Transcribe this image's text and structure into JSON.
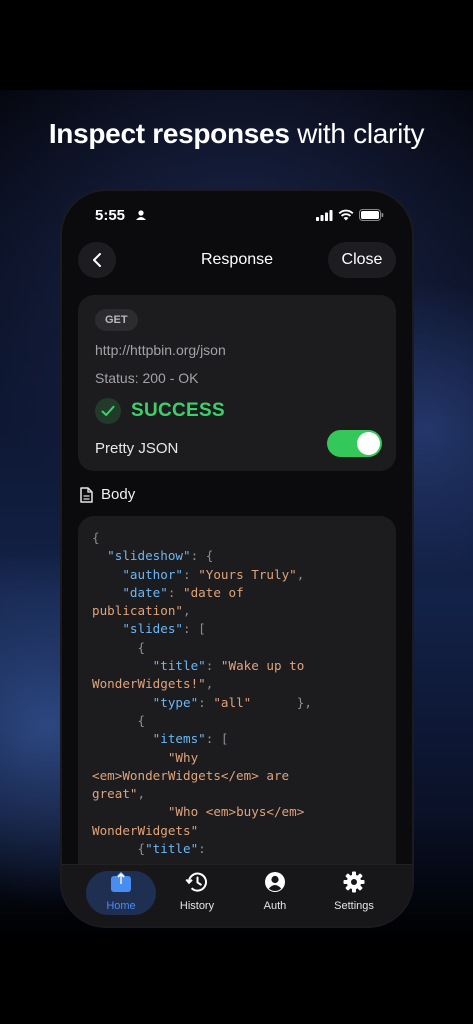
{
  "headline": {
    "strong": "Inspect responses",
    "rest": " with clarity"
  },
  "status_bar": {
    "time": "5:55"
  },
  "nav": {
    "title": "Response",
    "close_label": "Close"
  },
  "request": {
    "method": "GET",
    "url": "http://httpbin.org/json",
    "status": "Status: 200 - OK",
    "result": "SUCCESS",
    "pretty_label": "Pretty JSON",
    "pretty_on": true
  },
  "body_label": "Body",
  "code_lines": [
    [
      [
        "p",
        "{"
      ]
    ],
    [
      [
        "p",
        "  "
      ],
      [
        "k",
        "\"slideshow\""
      ],
      [
        "p",
        ": {"
      ]
    ],
    [
      [
        "p",
        "    "
      ],
      [
        "k",
        "\"author\""
      ],
      [
        "p",
        ": "
      ],
      [
        "s",
        "\"Yours Truly\""
      ],
      [
        "p",
        ","
      ]
    ],
    [
      [
        "p",
        "    "
      ],
      [
        "k",
        "\"date\""
      ],
      [
        "p",
        ": "
      ],
      [
        "s",
        "\"date of"
      ]
    ],
    [
      [
        "s",
        "publication\""
      ],
      [
        "p",
        ","
      ]
    ],
    [
      [
        "p",
        "    "
      ],
      [
        "k",
        "\"slides\""
      ],
      [
        "p",
        ": ["
      ]
    ],
    [
      [
        "p",
        "      {"
      ]
    ],
    [
      [
        "p",
        "        "
      ],
      [
        "k",
        "\"title\""
      ],
      [
        "p",
        ": "
      ],
      [
        "s",
        "\"Wake up to"
      ]
    ],
    [
      [
        "s",
        "WonderWidgets!\""
      ],
      [
        "p",
        ","
      ]
    ],
    [
      [
        "p",
        "        "
      ],
      [
        "k",
        "\"type\""
      ],
      [
        "p",
        ": "
      ],
      [
        "s",
        "\"all\""
      ],
      [
        "p",
        "      },"
      ]
    ],
    [
      [
        "p",
        "      {"
      ]
    ],
    [
      [
        "p",
        "        "
      ],
      [
        "k",
        "\"items\""
      ],
      [
        "p",
        ": ["
      ]
    ],
    [
      [
        "p",
        "          "
      ],
      [
        "s",
        "\"Why"
      ]
    ],
    [
      [
        "s",
        "<em>WonderWidgets</em> are"
      ]
    ],
    [
      [
        "s",
        "great\""
      ],
      [
        "p",
        ","
      ]
    ],
    [
      [
        "p",
        "          "
      ],
      [
        "s",
        "\"Who <em>buys</em>"
      ]
    ],
    [
      [
        "s",
        "WonderWidgets\""
      ]
    ],
    [
      [
        "p",
        "      {"
      ],
      [
        "k",
        "\"title\""
      ],
      [
        "p",
        ":"
      ]
    ]
  ],
  "tabs": [
    {
      "label": "Home",
      "icon": "home-upload-icon",
      "active": true
    },
    {
      "label": "History",
      "icon": "history-icon",
      "active": false
    },
    {
      "label": "Auth",
      "icon": "person-circle-icon",
      "active": false
    },
    {
      "label": "Settings",
      "icon": "gear-icon",
      "active": false
    }
  ],
  "colors": {
    "accent": "#4a8df0",
    "success": "#3ecf6a",
    "toggle": "#34c759",
    "json_key": "#6cb6f5",
    "json_string": "#e0a27a"
  }
}
